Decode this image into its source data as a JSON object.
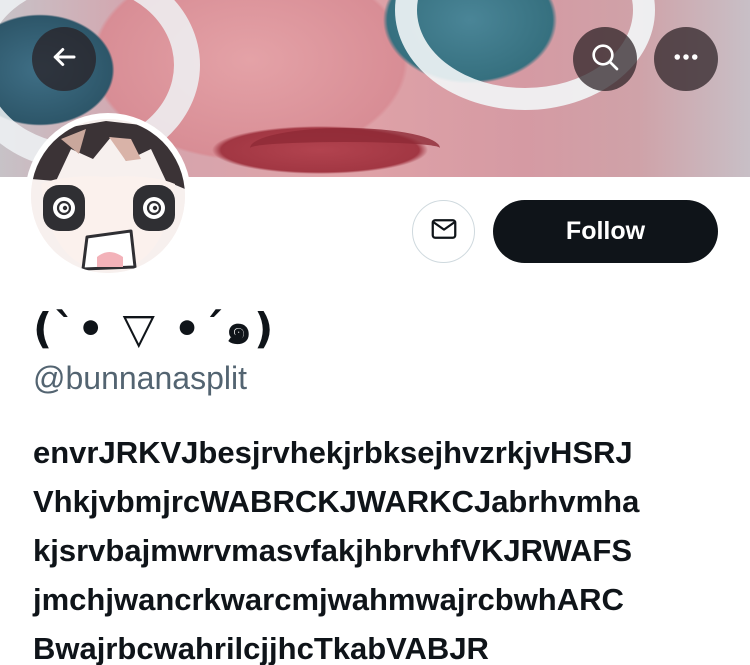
{
  "header": {
    "back_icon": "arrow-left-icon",
    "search_icon": "search-icon",
    "more_icon": "more-horizontal-icon"
  },
  "profile": {
    "display_name": "(`• ▽ •´๑)",
    "handle": "@bunnanasplit",
    "bio_lines": [
      "envrJRKVJbesjrvhekjrbksejhvzrkjvHSRJ",
      "VhkjvbmjrcWABRCKJWARKCJabrhvmha",
      "kjsrvbajmwrvmasvfakjhbrvhfVKJRWAFS",
      "jmchjwancrkwarcmjwahmwajrcbwhARC",
      "BwajrbcwahrilcjjhcTkabVABJR"
    ]
  },
  "actions": {
    "message_icon": "envelope-icon",
    "follow_label": "Follow"
  },
  "colors": {
    "follow_bg": "#0f1419",
    "handle_gray": "#536471",
    "button_border": "#cfd9de"
  }
}
